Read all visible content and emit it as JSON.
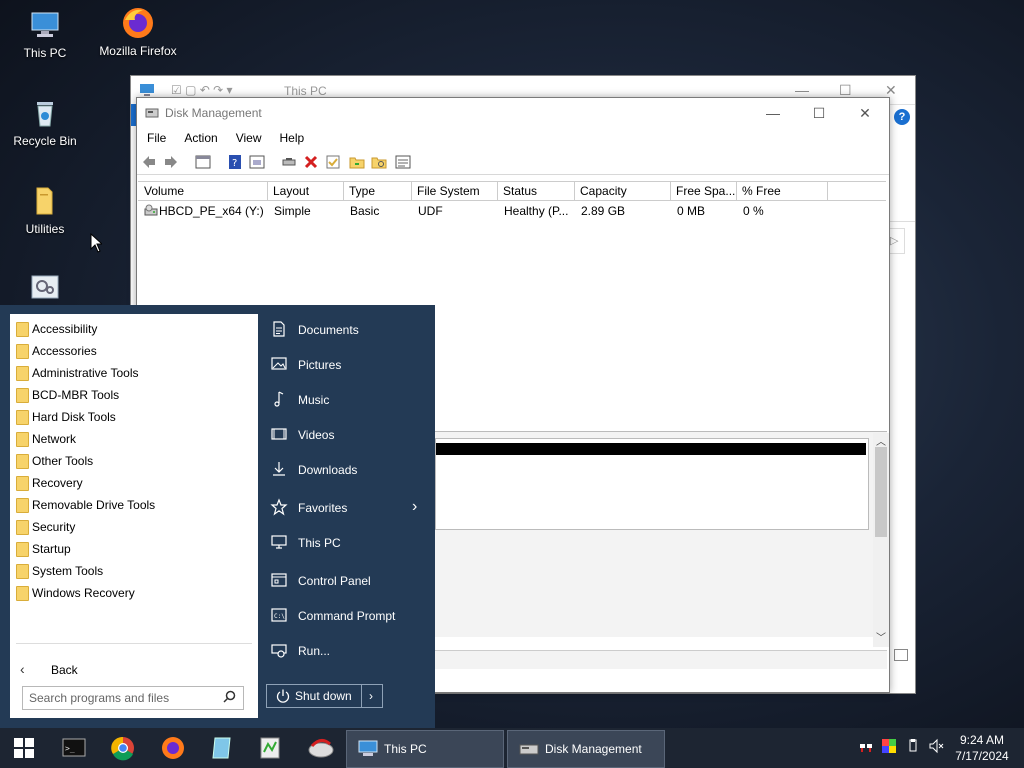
{
  "desktop": {
    "icons": [
      {
        "label": "This PC",
        "icon": "computer-icon"
      },
      {
        "label": "Mozilla Firefox",
        "icon": "firefox-icon"
      },
      {
        "label": "Recycle Bin",
        "icon": "recycle-bin-icon"
      },
      {
        "label": "Utilities",
        "icon": "folder-icon"
      },
      {
        "label": "",
        "icon": "settings-app-icon"
      }
    ]
  },
  "explorer": {
    "title": "This PC"
  },
  "disk_management": {
    "title": "Disk Management",
    "menu": [
      "File",
      "Action",
      "View",
      "Help"
    ],
    "columns": [
      "Volume",
      "Layout",
      "Type",
      "File System",
      "Status",
      "Capacity",
      "Free Spa...",
      "% Free"
    ],
    "rows": [
      {
        "volume": "HBCD_PE_x64 (Y:)",
        "layout": "Simple",
        "type": "Basic",
        "fs": "UDF",
        "status": "Healthy (P...",
        "capacity": "2.89 GB",
        "free": "0 MB",
        "pct_free": "0 %"
      }
    ]
  },
  "start_menu": {
    "programs": [
      "Accessibility",
      "Accessories",
      "Administrative Tools",
      "BCD-MBR Tools",
      "Hard Disk Tools",
      "Network",
      "Other Tools",
      "Recovery",
      "Removable Drive Tools",
      "Security",
      "Startup",
      "System Tools",
      "Windows Recovery"
    ],
    "back_label": "Back",
    "search_placeholder": "Search programs and files",
    "links": [
      {
        "label": "Documents",
        "icon": "document-icon"
      },
      {
        "label": "Pictures",
        "icon": "pictures-icon"
      },
      {
        "label": "Music",
        "icon": "music-icon"
      },
      {
        "label": "Videos",
        "icon": "videos-icon"
      },
      {
        "label": "Downloads",
        "icon": "downloads-icon"
      },
      {
        "label": "Favorites",
        "icon": "star-icon"
      },
      {
        "label": "This PC",
        "icon": "computer-icon"
      },
      {
        "label": "Control Panel",
        "icon": "control-panel-icon"
      },
      {
        "label": "Command Prompt",
        "icon": "command-prompt-icon"
      },
      {
        "label": "Run...",
        "icon": "run-icon"
      }
    ],
    "shutdown_label": "Shut down"
  },
  "taskbar": {
    "buttons": [
      {
        "label": "This PC"
      },
      {
        "label": "Disk Management"
      }
    ],
    "time": "9:24 AM",
    "date": "7/17/2024"
  },
  "colors": {
    "start_menu_bg": "#233a55",
    "taskbar_bg": "#1d2532",
    "folder": "#f7d36a",
    "delete_red": "#d42020"
  }
}
